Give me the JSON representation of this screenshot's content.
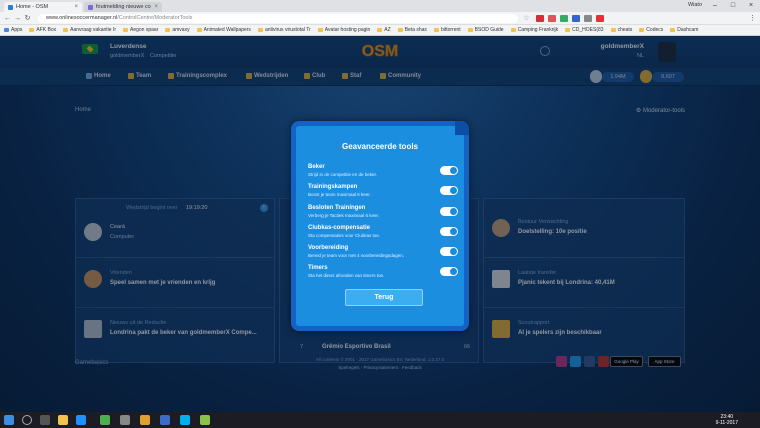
{
  "browser": {
    "tabs": [
      {
        "title": "Home - OSM",
        "active": true
      },
      {
        "title": "foutmelding nieuwe co",
        "active": false
      }
    ],
    "window_user": "Wiato",
    "url_host": "www.onlinesoccermanager.nl",
    "url_path": "/ControlCentre/ModeratorTools",
    "bookmarks": [
      "Apps",
      "AFK Box",
      "Aanvraag vakantie Ir",
      "Aegon spaar",
      "amvaxy",
      "Animated Wallpapers",
      "antivirus virustotal Tr",
      "Avatar hosting pagin",
      "AZ",
      "Beta shas",
      "bittorrent",
      "BSOD Guide",
      "Camping Frankrijk",
      "CD_HOES(83",
      "cheats",
      "Codecs",
      "Dashcam"
    ]
  },
  "club": {
    "name": "Luverdense",
    "owner": "goldmemberX",
    "subtitle": "Competitie"
  },
  "logo": "OSM",
  "user": {
    "name": "goldmemberX",
    "subtitle": "NL"
  },
  "nav": [
    "Home",
    "Team",
    "Trainingscomplex",
    "Wedstrijden",
    "Club",
    "Staf",
    "Community"
  ],
  "currency": {
    "savings": "1.94M",
    "coins": "8,607"
  },
  "breadcrumb": "Home",
  "moderator_link": "Moderator-tools",
  "cards": {
    "match_time": "19:19:20",
    "match_label": "Wedstrijd begint over",
    "opponent": "Ceará",
    "opponent_sub": "Computer",
    "friends_title": "Vrienden",
    "friends_text": "Speel samen met je vrienden en krijg",
    "news_title": "Nieuws uit de Redactie",
    "news_text": "Londrina pakt de beker van goldmemberX Compe...",
    "board_title": "Bestuur Verwachting",
    "board_text": "Doelstelling: 10e positie",
    "transfer_title": "Laatste transfer",
    "transfer_text": "Pjanic tekent bij Londrina: 40,41M",
    "scout_title": "Scoutrapport",
    "scout_text": "Al je spelers zijn beschikbaar",
    "table_row_pos": "7",
    "table_row_team": "Grêmio Esportivo Brasil",
    "table_row_pts": "66"
  },
  "modal": {
    "title": "Geavanceerde tools",
    "settings": [
      {
        "title": "Beker",
        "desc": "Strijd in de competitie en de beker."
      },
      {
        "title": "Trainingskampen",
        "desc": "Boost je team maximaal 6 keer."
      },
      {
        "title": "Besloten Trainingen",
        "desc": "Verberg je Tactiek maximaal 6 keer."
      },
      {
        "title": "Clubkas-compensatie",
        "desc": "Sta compensaties voor Clubkas toe."
      },
      {
        "title": "Voorbereiding",
        "desc": "Bereid je team voor met 4 voorbereidingsdagen."
      },
      {
        "title": "Timers",
        "desc": "Sta het direct afronden van timers toe."
      }
    ],
    "back_label": "Terug"
  },
  "footer": {
    "brand": "Gamebasics",
    "copyright": "All contents © 2001 - 2017 Gamebasics BV, Nederland. 1.0.27.0",
    "links": "Spelregels · Privacystatement · Feedback",
    "google_play": "Google Play",
    "app_store": "App Store"
  },
  "taskbar": {
    "time": "23:40",
    "date": "9-11-2017"
  },
  "colors": {
    "modal_bg": "#1c8ee0",
    "modal_border": "#1463c4",
    "button": "#3aaef0",
    "toggle_on": "#1a8bdc"
  }
}
